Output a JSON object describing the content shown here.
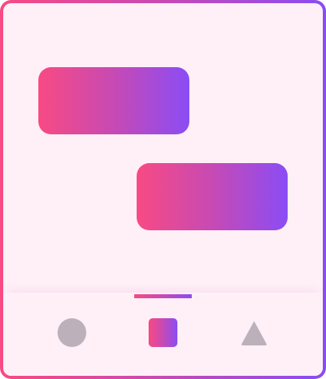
{
  "colors": {
    "gradient_start": "#f84a83",
    "gradient_mid": "#c74ab4",
    "gradient_end": "#8a4cf5",
    "background": "#fff0f8",
    "inactive_icon": "#bcb1bb"
  },
  "content": {
    "cards": [
      {
        "name": "gradient-card-1"
      },
      {
        "name": "gradient-card-2"
      }
    ]
  },
  "bottom_nav": {
    "selected_index": 1,
    "items": [
      {
        "icon": "circle-icon",
        "selected": false
      },
      {
        "icon": "square-icon",
        "selected": true
      },
      {
        "icon": "triangle-icon",
        "selected": false
      }
    ]
  }
}
